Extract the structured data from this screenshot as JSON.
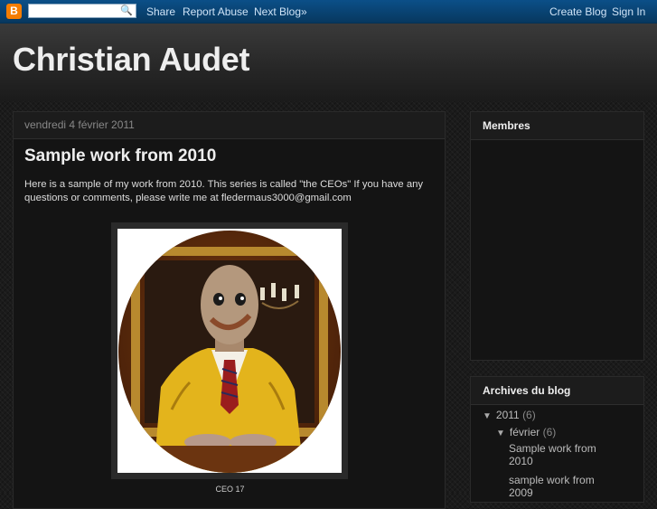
{
  "navbar": {
    "logo": "B",
    "search_placeholder": "",
    "share": "Share",
    "report_abuse": "Report Abuse",
    "next_blog": "Next Blog»",
    "create_blog": "Create Blog",
    "sign_in": "Sign In"
  },
  "header": {
    "title": "Christian Audet"
  },
  "post": {
    "date": "vendredi 4 février 2011",
    "title": "Sample work from 2010",
    "body": "Here is a sample of my work from 2010. This series is called \"the CEOs\"  If you have any questions or comments, please write me at fledermaus3000@gmail.com",
    "caption": "CEO 17"
  },
  "sidebar": {
    "members_title": "Membres",
    "archive_title": "Archives du blog",
    "year": {
      "label": "2011",
      "count": "(6)"
    },
    "month": {
      "label": "février",
      "count": "(6)"
    },
    "posts": [
      "Sample work from 2010",
      "sample work from 2009"
    ]
  },
  "colors": {
    "navbar": "#0b4f88",
    "background": "#1b1b1b",
    "blogger_orange": "#f57d00",
    "jacket": "#e8b820"
  }
}
